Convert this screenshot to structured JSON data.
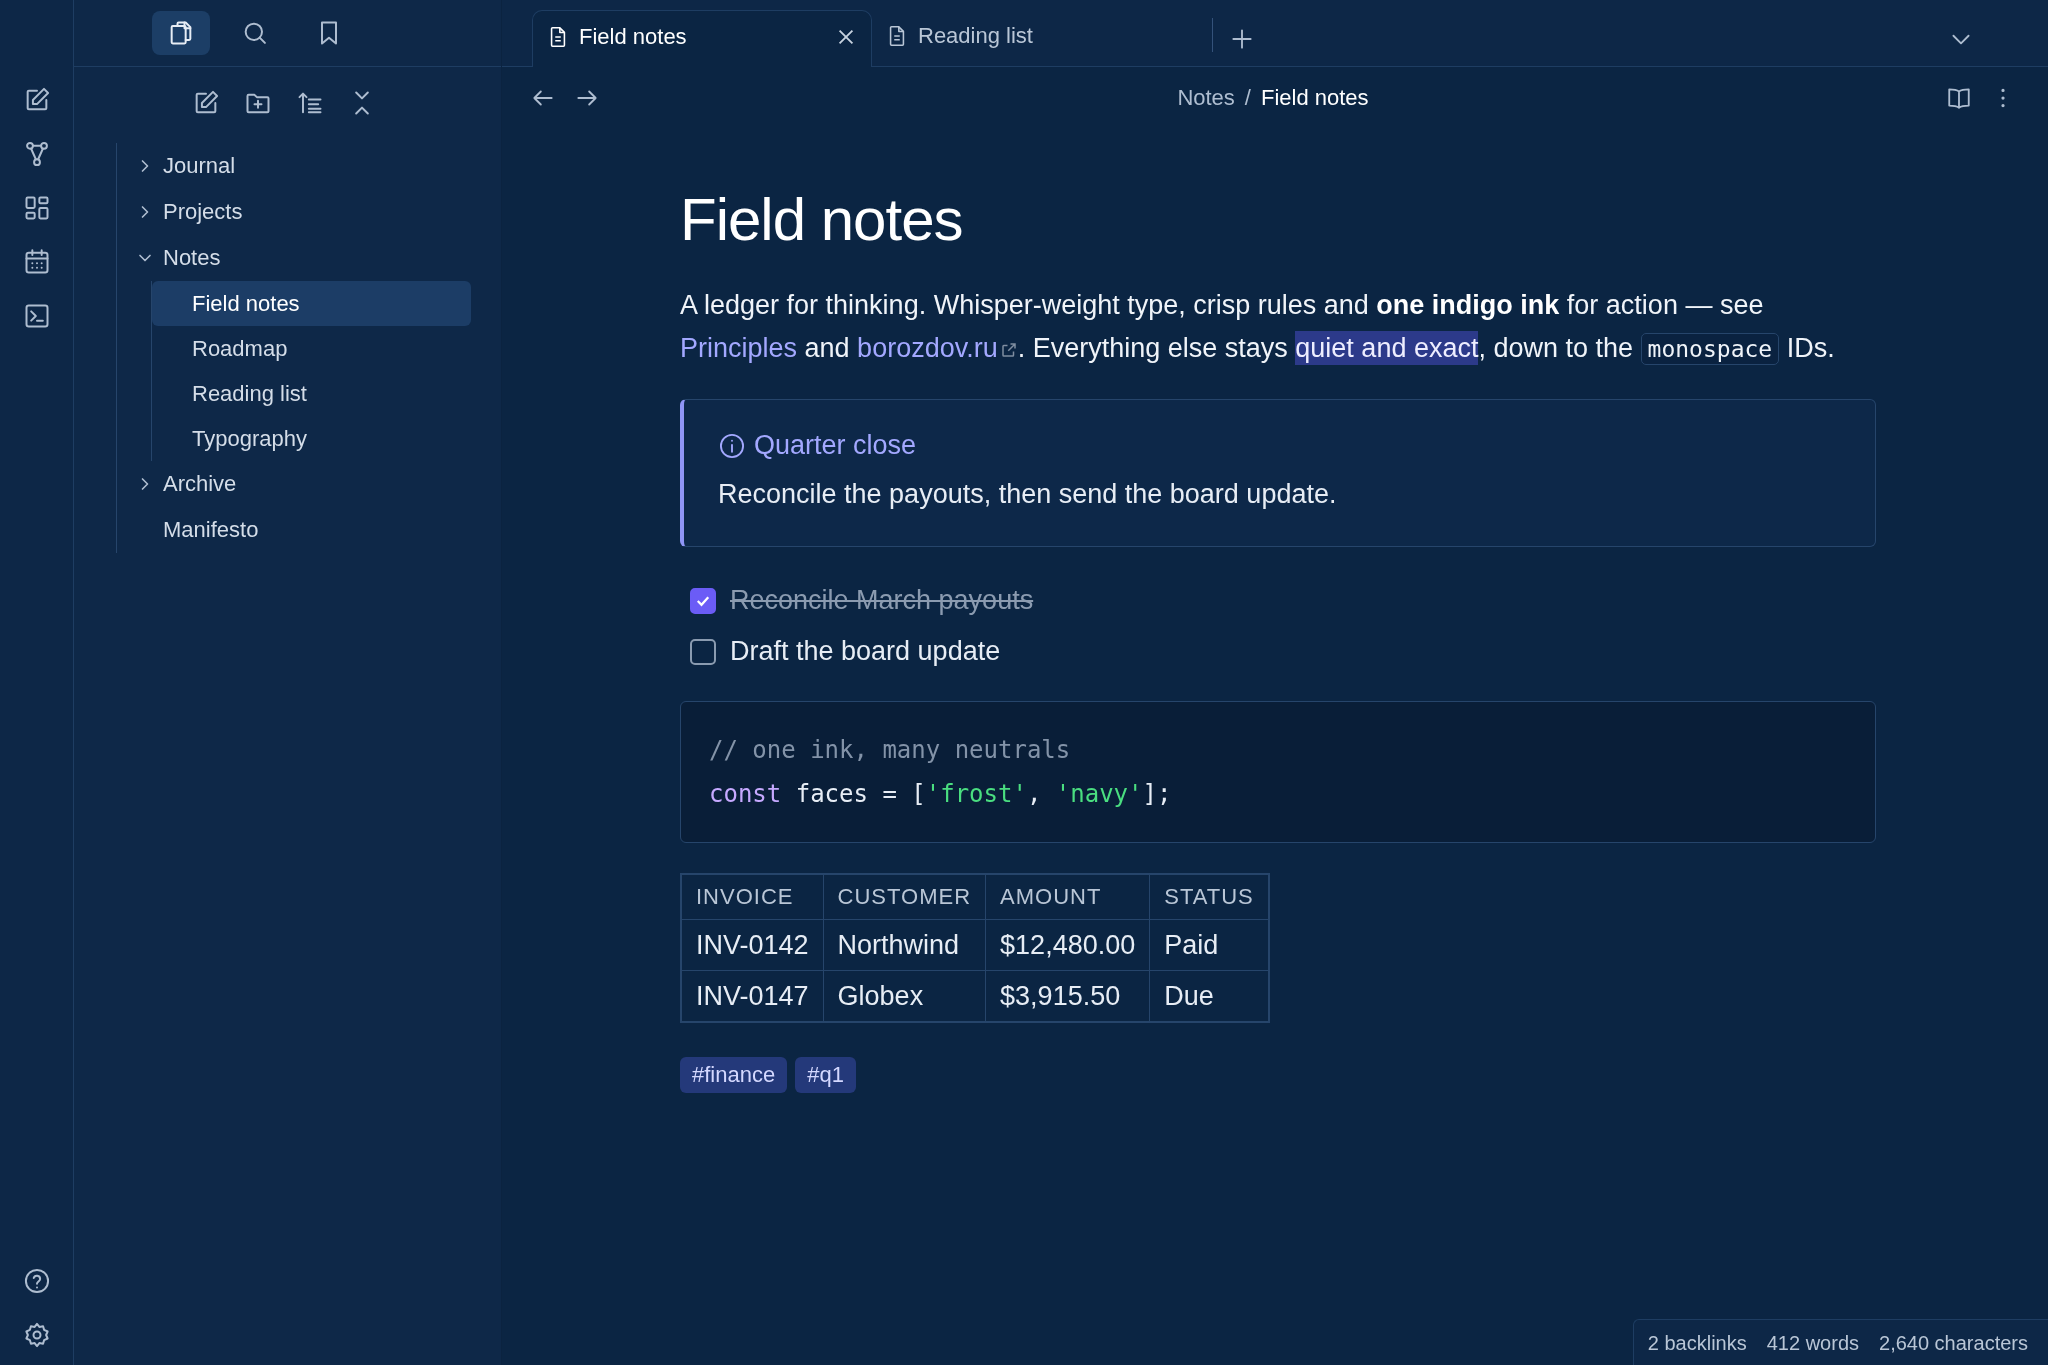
{
  "ribbon": {
    "top": [
      {
        "kind": "edit"
      },
      {
        "kind": "graph"
      },
      {
        "kind": "grid"
      },
      {
        "kind": "calendar"
      },
      {
        "kind": "terminal"
      }
    ],
    "bottom": [
      {
        "kind": "help"
      },
      {
        "kind": "settings"
      }
    ]
  },
  "sidebar_tabs": [
    {
      "kind": "files",
      "selected": true
    },
    {
      "kind": "search",
      "selected": false
    },
    {
      "kind": "bookmark",
      "selected": false
    }
  ],
  "sidebar_toolbar": [
    {
      "kind": "edit"
    },
    {
      "kind": "folder"
    },
    {
      "kind": "sort"
    },
    {
      "kind": "collapse"
    }
  ],
  "tree": [
    {
      "label": "Journal",
      "folder": true,
      "expanded": false,
      "selected": false
    },
    {
      "label": "Projects",
      "folder": true,
      "expanded": false,
      "selected": false
    },
    {
      "label": "Notes",
      "folder": true,
      "expanded": true,
      "selected": false,
      "children": [
        {
          "label": "Field notes",
          "selected": true
        },
        {
          "label": "Roadmap",
          "selected": false
        },
        {
          "label": "Reading list",
          "selected": false
        },
        {
          "label": "Typography",
          "selected": false
        }
      ]
    },
    {
      "label": "Archive",
      "folder": true,
      "expanded": false,
      "selected": false
    },
    {
      "label": "Manifesto",
      "folder": false,
      "selected": false
    }
  ],
  "tabs": [
    {
      "label": "Field notes",
      "selected": true,
      "closable": true
    },
    {
      "label": "Reading list",
      "selected": false,
      "closable": false
    }
  ],
  "breadcrumb": {
    "items": [
      "Notes",
      "Field notes"
    ],
    "separator": "/"
  },
  "note": {
    "title": "Field notes",
    "paragraph": [
      {
        "kind": "text",
        "text": "A ledger for thinking. Whisper-weight type, crisp rules and "
      },
      {
        "kind": "bold",
        "text": "one indigo ink"
      },
      {
        "kind": "text",
        "text": " for action — see "
      },
      {
        "kind": "link",
        "text": "Principles"
      },
      {
        "kind": "text",
        "text": " and "
      },
      {
        "kind": "extlink",
        "text": "borozdov.ru"
      },
      {
        "kind": "text",
        "text": ". Everything else stays "
      },
      {
        "kind": "highlight",
        "text": "quiet and exact"
      },
      {
        "kind": "text",
        "text": ", down to the "
      },
      {
        "kind": "code",
        "text": "monospace"
      },
      {
        "kind": "text",
        "text": " IDs."
      }
    ],
    "callout": {
      "title": "Quarter close",
      "body": "Reconcile the payouts, then send the board update."
    },
    "tasks": [
      {
        "text": "Reconcile March payouts",
        "checked": true
      },
      {
        "text": "Draft the board update",
        "checked": false
      }
    ],
    "code": [
      [
        {
          "kind": "comment",
          "text": "// one ink, many neutrals"
        }
      ],
      [
        {
          "kind": "keyword",
          "text": "const"
        },
        {
          "kind": "plain",
          "text": " faces = ["
        },
        {
          "kind": "string",
          "text": "'frost'"
        },
        {
          "kind": "plain",
          "text": ", "
        },
        {
          "kind": "string",
          "text": "'navy'"
        },
        {
          "kind": "plain",
          "text": "];"
        }
      ]
    ],
    "table": {
      "columns": [
        "INVOICE",
        "CUSTOMER",
        "AMOUNT",
        "STATUS"
      ],
      "rows": [
        [
          "INV-0142",
          "Northwind",
          "$12,480.00",
          "Paid"
        ],
        [
          "INV-0147",
          "Globex",
          "$3,915.50",
          "Due"
        ]
      ]
    },
    "tags": [
      "#finance",
      "#q1"
    ]
  },
  "status_bar": [
    "2 backlinks",
    "412 words",
    "2,640 characters"
  ]
}
